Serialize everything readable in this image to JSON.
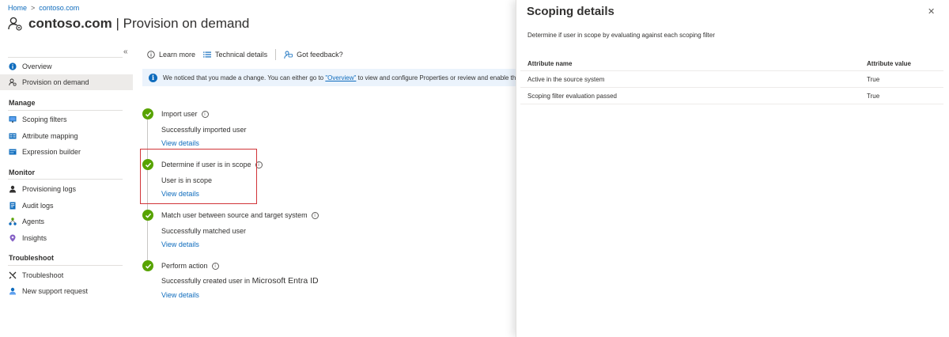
{
  "breadcrumb": {
    "home": "Home",
    "separator": ">",
    "tenant": "contoso.com"
  },
  "header": {
    "title_strong": "contoso.com",
    "title_rest": " | Provision on demand",
    "more": "···"
  },
  "sidebar": {
    "collapse": "«",
    "top_items": [
      {
        "label": "Overview",
        "icon": "info-icon"
      },
      {
        "label": "Provision on demand",
        "icon": "user-provision-icon",
        "selected": true
      }
    ],
    "sections": [
      {
        "label": "Manage",
        "items": [
          {
            "label": "Scoping filters",
            "icon": "scoping-filter-icon"
          },
          {
            "label": "Attribute mapping",
            "icon": "attribute-mapping-icon"
          },
          {
            "label": "Expression builder",
            "icon": "expression-builder-icon"
          }
        ]
      },
      {
        "label": "Monitor",
        "items": [
          {
            "label": "Provisioning logs",
            "icon": "provisioning-logs-icon"
          },
          {
            "label": "Audit logs",
            "icon": "audit-logs-icon"
          },
          {
            "label": "Agents",
            "icon": "agents-icon"
          },
          {
            "label": "Insights",
            "icon": "insights-icon"
          }
        ]
      },
      {
        "label": "Troubleshoot",
        "items": [
          {
            "label": "Troubleshoot",
            "icon": "troubleshoot-icon"
          },
          {
            "label": "New support request",
            "icon": "support-request-icon"
          }
        ]
      }
    ]
  },
  "toolbar": {
    "learn_more": "Learn more",
    "technical_details": "Technical details",
    "feedback": "Got feedback?"
  },
  "banner": {
    "text_before": "We noticed that you made a change. You can either go to ",
    "link": "\"Overview\"",
    "text_after": " to view and configure Properties or review and enable this co"
  },
  "steps": [
    {
      "title": "Import user",
      "status": "Successfully imported user",
      "link": "View details"
    },
    {
      "title": "Determine if user is in scope",
      "status": "User is in scope",
      "link": "View details"
    },
    {
      "title": "Match user between source and target system",
      "status": "Successfully matched user",
      "link": "View details"
    },
    {
      "title": "Perform action",
      "status": "Successfully created user in ",
      "status_emph": "Microsoft Entra ID",
      "link": "View details"
    }
  ],
  "panel": {
    "title": "Scoping details",
    "close": "✕",
    "description": "Determine if user in scope by evaluating against each scoping filter",
    "columns": [
      "Attribute name",
      "Attribute value"
    ],
    "rows": [
      [
        "Active in the source system",
        "True"
      ],
      [
        "Scoping filter evaluation passed",
        "True"
      ]
    ]
  },
  "colors": {
    "accent": "#0f6cbd",
    "success": "#57a300",
    "highlight": "#d13438",
    "banner_bg": "#ebf3fc",
    "selected_bg": "#edebe9"
  }
}
